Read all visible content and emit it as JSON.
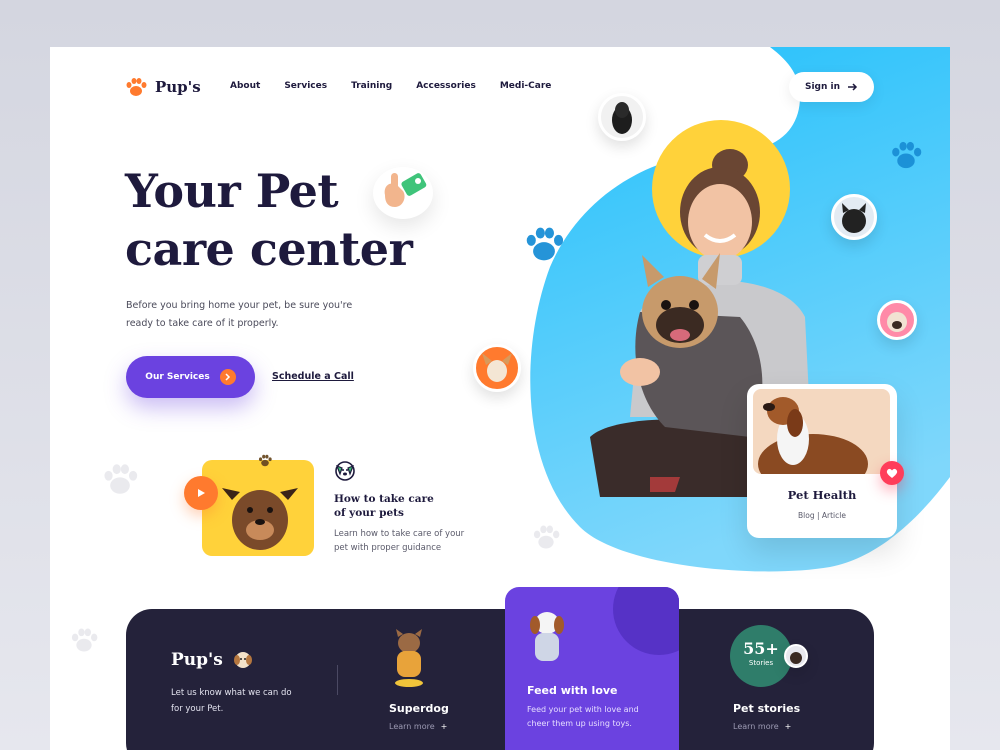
{
  "brand": {
    "name": "Pup's",
    "accent": "#6b42e0",
    "orange": "#ff7a2e",
    "navy": "#1e1a3d"
  },
  "nav": {
    "items": [
      "About",
      "Services",
      "Training",
      "Accessories",
      "Medi-Care"
    ]
  },
  "header": {
    "signin_label": "Sign in",
    "signin_icon": "arrow-right-icon"
  },
  "hero": {
    "title_line1": "Your Pet",
    "title_line2": "care center",
    "description": "Before you bring home your pet, be sure you're ready to take care of it properly.",
    "primary_button": "Our Services",
    "secondary_link": "Schedule a Call"
  },
  "guide": {
    "title_line1": "How to take care",
    "title_line2": "of your pets",
    "description": "Learn how to take care of your pet with proper guidance"
  },
  "health_card": {
    "title": "Pet Health",
    "meta": "Blog  |  Article"
  },
  "bottom": {
    "brand": "Pup's",
    "description": "Let us know what we can do for your Pet.",
    "features": [
      {
        "title": "Superdog",
        "link": "Learn more"
      },
      {
        "title": "Feed with love",
        "description": "Feed your pet with love and cheer them up using toys."
      },
      {
        "title": "Pet stories",
        "link": "Learn more"
      }
    ],
    "stories_count": "55+",
    "stories_label": "Stories"
  }
}
